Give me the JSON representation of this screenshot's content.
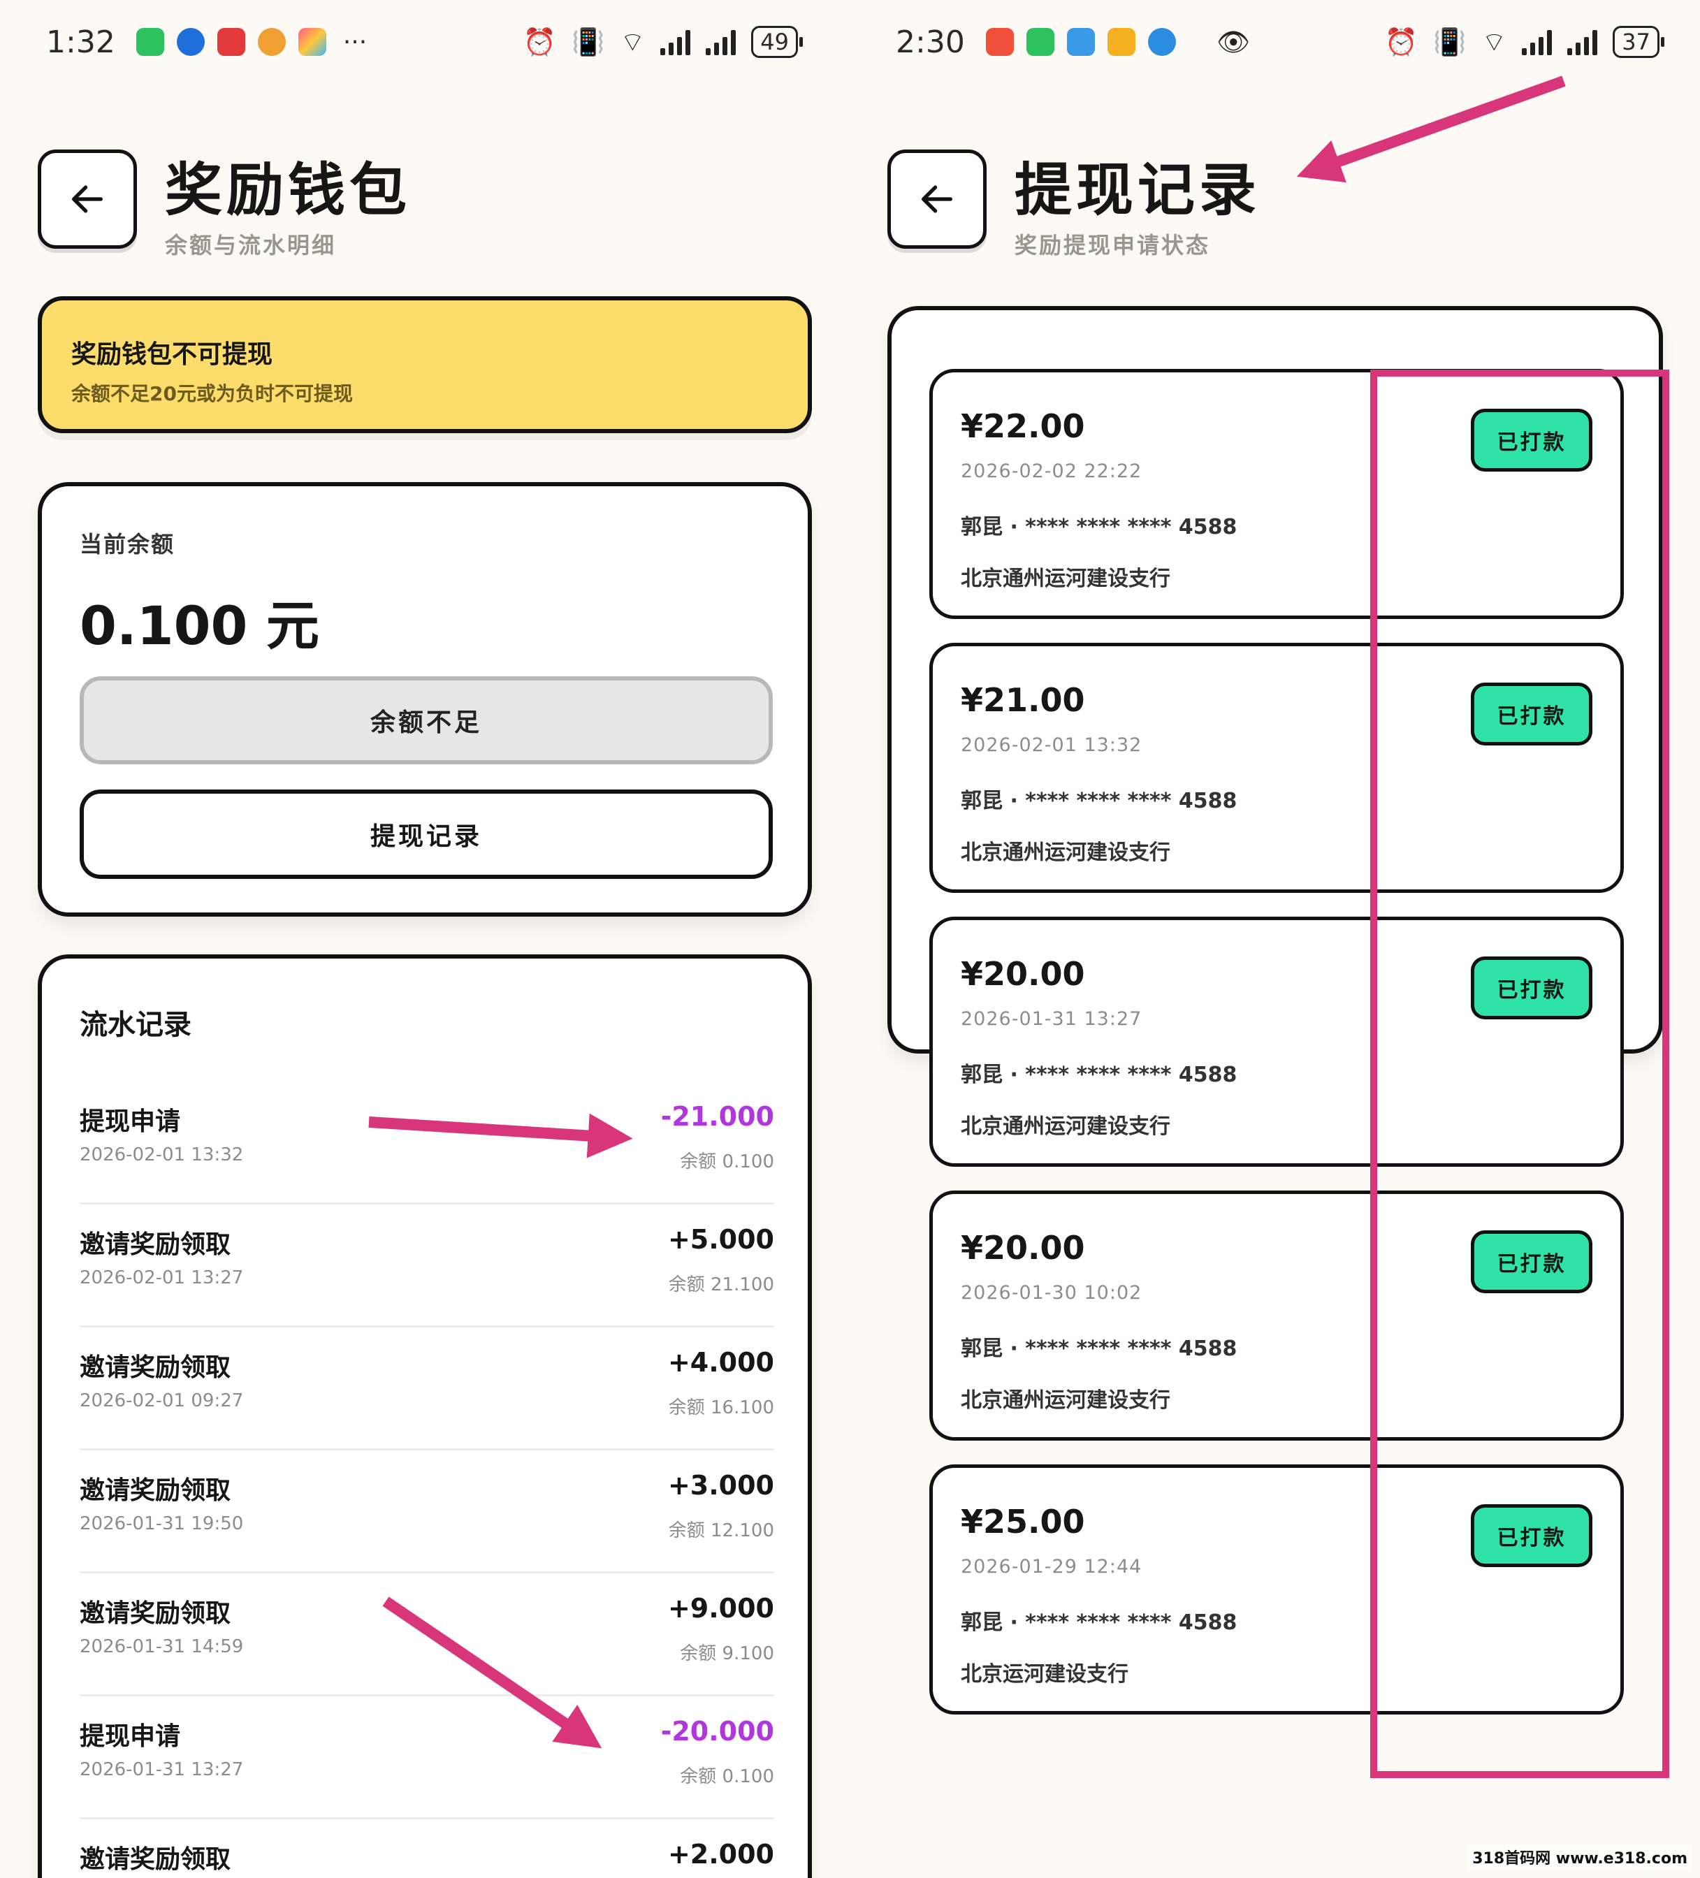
{
  "left": {
    "status": {
      "time": "1:32",
      "battery": "49"
    },
    "header": {
      "title": "奖励钱包",
      "subtitle": "余额与流水明细"
    },
    "notice": {
      "title": "奖励钱包不可提现",
      "desc": "余额不足20元或为负时不可提现"
    },
    "balance": {
      "label": "当前余额",
      "value": "0.100 元",
      "insufficient_button": "余额不足",
      "records_button": "提现记录"
    },
    "flow": {
      "title": "流水记录",
      "rows": [
        {
          "title": "提现申请",
          "date": "2026-02-01 13:32",
          "amount": "-21.000",
          "balance": "余额 0.100",
          "negative": true
        },
        {
          "title": "邀请奖励领取",
          "date": "2026-02-01 13:27",
          "amount": "+5.000",
          "balance": "余额 21.100",
          "negative": false
        },
        {
          "title": "邀请奖励领取",
          "date": "2026-02-01 09:27",
          "amount": "+4.000",
          "balance": "余额 16.100",
          "negative": false
        },
        {
          "title": "邀请奖励领取",
          "date": "2026-01-31 19:50",
          "amount": "+3.000",
          "balance": "余额 12.100",
          "negative": false
        },
        {
          "title": "邀请奖励领取",
          "date": "2026-01-31 14:59",
          "amount": "+9.000",
          "balance": "余额 9.100",
          "negative": false
        },
        {
          "title": "提现申请",
          "date": "2026-01-31 13:27",
          "amount": "-20.000",
          "balance": "余额 0.100",
          "negative": true
        },
        {
          "title": "邀请奖励领取",
          "date": "",
          "amount": "+2.000",
          "balance": "",
          "negative": false
        }
      ]
    }
  },
  "right": {
    "status": {
      "time": "2:30",
      "battery": "37"
    },
    "header": {
      "title": "提现记录",
      "subtitle": "奖励提现申请状态"
    },
    "records": [
      {
        "amount": "¥22.00",
        "date": "2026-02-02 22:22",
        "card": "郭昆 · **** **** **** 4588",
        "bank": "北京通州运河建设支行",
        "status": "已打款"
      },
      {
        "amount": "¥21.00",
        "date": "2026-02-01 13:32",
        "card": "郭昆 · **** **** **** 4588",
        "bank": "北京通州运河建设支行",
        "status": "已打款"
      },
      {
        "amount": "¥20.00",
        "date": "2026-01-31 13:27",
        "card": "郭昆 · **** **** **** 4588",
        "bank": "北京通州运河建设支行",
        "status": "已打款"
      },
      {
        "amount": "¥20.00",
        "date": "2026-01-30 10:02",
        "card": "郭昆 · **** **** **** 4588",
        "bank": "北京通州运河建设支行",
        "status": "已打款"
      },
      {
        "amount": "¥25.00",
        "date": "2026-01-29 12:44",
        "card": "郭昆 · **** **** **** 4588",
        "bank": "北京运河建设支行",
        "status": "已打款"
      }
    ]
  },
  "watermark": "318首码网 www.e318.com",
  "colors": {
    "background": "#fdfaf5",
    "notice": "#fcdc6b",
    "negative_amount": "#b236e0",
    "status_badge": "#2fe3a8",
    "annotation": "#d9357a"
  }
}
